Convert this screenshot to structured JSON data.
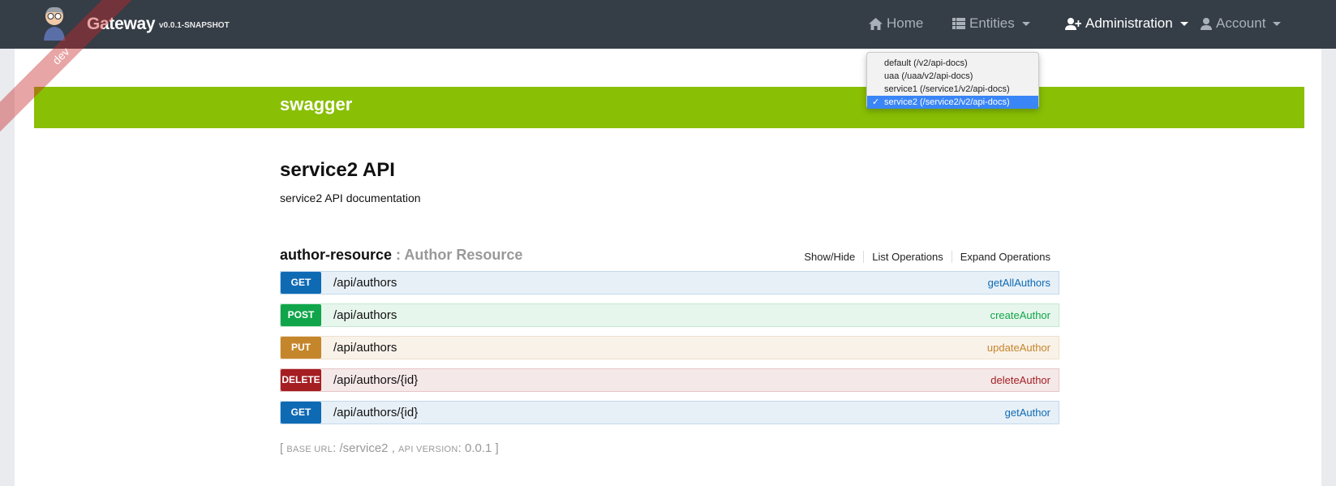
{
  "navbar": {
    "brand": "Gateway",
    "version": "v0.0.1-SNAPSHOT",
    "ribbon": "dev",
    "items": [
      {
        "label": "Home",
        "icon": "home-icon"
      },
      {
        "label": "Entities",
        "icon": "th-list-icon"
      },
      {
        "label": "Administration",
        "icon": "user-plus-icon"
      },
      {
        "label": "Account",
        "icon": "user-icon"
      }
    ]
  },
  "swagger": {
    "title": "swagger",
    "spec_dropdown": {
      "options": [
        "default (/v2/api-docs)",
        "uaa (/uaa/v2/api-docs)",
        "service1 (/service1/v2/api-docs)",
        "service2 (/service2/v2/api-docs)"
      ],
      "selected": "service2 (/service2/v2/api-docs)",
      "check": "✓"
    }
  },
  "api": {
    "title": "service2 API",
    "description": "service2 API documentation"
  },
  "resource": {
    "name": "author-resource",
    "separator": " : ",
    "description": "Author Resource",
    "actions": [
      "Show/Hide",
      "List Operations",
      "Expand Operations"
    ]
  },
  "operations": [
    {
      "method": "GET",
      "path": "/api/authors",
      "nickname": "getAllAuthors"
    },
    {
      "method": "POST",
      "path": "/api/authors",
      "nickname": "createAuthor"
    },
    {
      "method": "PUT",
      "path": "/api/authors",
      "nickname": "updateAuthor"
    },
    {
      "method": "DELETE",
      "path": "/api/authors/{id}",
      "nickname": "deleteAuthor"
    },
    {
      "method": "GET",
      "path": "/api/authors/{id}",
      "nickname": "getAuthor"
    }
  ],
  "footer": {
    "open": "[ ",
    "base_url_label": "Base url",
    "colon": ": ",
    "base_url": "/service2",
    "comma": " , ",
    "api_version_label": "Api version",
    "api_version": "0.0.1",
    "close": " ]"
  },
  "colors": {
    "navbar": "#353d47",
    "swagger_green": "#89bf04",
    "get": "#0f6ab4",
    "post": "#10a54a",
    "put": "#c5862b",
    "delete": "#a41e22",
    "selection": "#3a86f6"
  }
}
